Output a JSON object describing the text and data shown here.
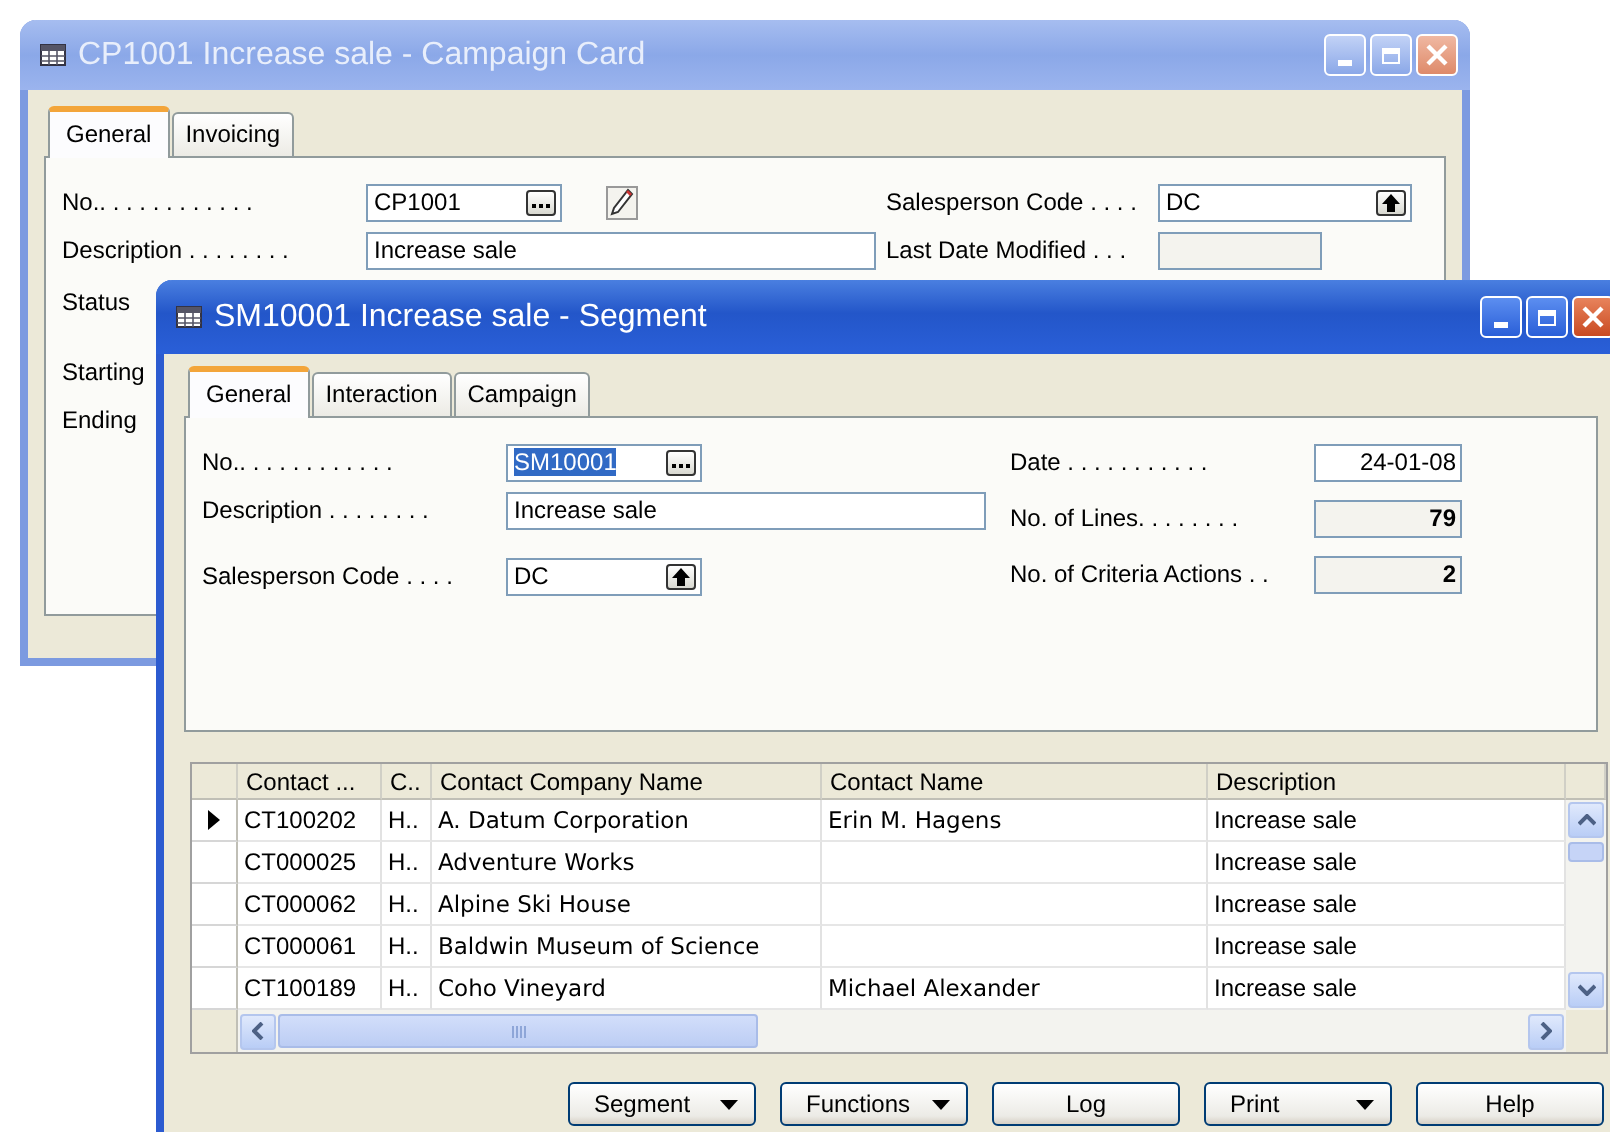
{
  "windows": [
    {
      "title": "CP1001 Increase sale - Campaign Card",
      "active": false,
      "tabs": [
        {
          "label": "General",
          "selected": true
        },
        {
          "label": "Invoicing",
          "selected": false
        }
      ],
      "left_fields": [
        {
          "label": "No.. . . . . . . . . . . .",
          "value": "CP1001",
          "kind": "lookup",
          "editable": true,
          "highlighted": false,
          "assist_edit": true
        },
        {
          "label": "Description . . . . . . . .",
          "value": "Increase sale",
          "kind": "text",
          "editable": true,
          "highlighted": false,
          "assist_edit": false
        }
      ],
      "right_fields": [
        {
          "label": "Salesperson Code . . . .",
          "value": "DC",
          "kind": "option",
          "editable": true,
          "highlighted": false,
          "assist_edit": false
        },
        {
          "label": "Last Date Modified . . .",
          "kind": "text",
          "editable": false,
          "assist_edit": false
        }
      ],
      "labels": [
        "Status",
        "Starting",
        "Ending"
      ]
    },
    {
      "title": "SM10001 Increase sale - Segment",
      "active": true,
      "tabs": [
        {
          "label": "General",
          "selected": true
        },
        {
          "label": "Interaction",
          "selected": false
        },
        {
          "label": "Campaign",
          "selected": false
        }
      ],
      "left_fields": [
        {
          "label": "No.. . . . . . . . . . . .",
          "value": "SM10001",
          "kind": "lookup",
          "editable": true,
          "highlighted": true,
          "assist_edit": false
        },
        {
          "label": "Description . . . . . . . .",
          "value": "Increase sale",
          "kind": "text",
          "editable": true,
          "highlighted": false,
          "assist_edit": false
        },
        {
          "label": "Salesperson Code . . . .",
          "value": "DC",
          "kind": "option",
          "editable": true,
          "highlighted": false,
          "assist_edit": false
        }
      ],
      "right_fields": [
        {
          "label": "Date . . . . . . . . . . .",
          "value": "24-01-08",
          "kind": "date",
          "editable": true,
          "highlighted": false,
          "assist_edit": false
        },
        {
          "label": "No. of Lines. . . . . . . .",
          "value": "79",
          "kind": "count",
          "editable": false,
          "highlighted": false,
          "assist_edit": false
        },
        {
          "label": "No. of Criteria Actions . .",
          "value": "2",
          "kind": "count",
          "editable": false,
          "highlighted": false,
          "assist_edit": false
        }
      ],
      "grid": {
        "columns": [
          "Contact ...",
          "C..",
          "Contact Company Name",
          "Contact Name",
          "Description"
        ],
        "rows": [
          {
            "selected": true,
            "cells": [
              "CT100202",
              "H..",
              "A. Datum Corporation",
              "Erin M. Hagens",
              "Increase sale"
            ]
          },
          {
            "selected": false,
            "cells": [
              "CT000025",
              "H..",
              "Adventure Works",
              "",
              "Increase sale"
            ]
          },
          {
            "selected": false,
            "cells": [
              "CT000062",
              "H..",
              "Alpine Ski House",
              "",
              "Increase sale"
            ]
          },
          {
            "selected": false,
            "cells": [
              "CT000061",
              "H..",
              "Baldwin Museum of Science",
              "",
              "Increase sale"
            ]
          },
          {
            "selected": false,
            "cells": [
              "CT100189",
              "H..",
              "Coho Vineyard",
              "Michael Alexander",
              "Increase sale"
            ]
          }
        ]
      },
      "buttons": [
        {
          "label": "Segment",
          "dropdown": true
        },
        {
          "label": "Functions",
          "dropdown": true
        },
        {
          "label": "Log",
          "dropdown": false
        },
        {
          "label": "Print",
          "dropdown": true
        },
        {
          "label": "Help",
          "dropdown": false
        }
      ]
    }
  ]
}
